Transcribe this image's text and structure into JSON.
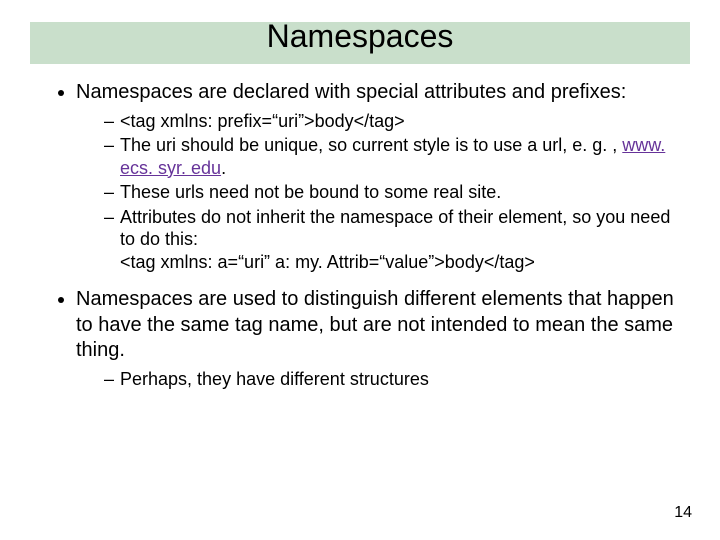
{
  "title": "Namespaces",
  "bullets": [
    {
      "text": "Namespaces are declared with special attributes and prefixes:",
      "sub": [
        {
          "text": "<tag xmlns: prefix=“uri”>body</tag>"
        },
        {
          "pre": "The uri should be unique, so current style is to use a url, e. g. , ",
          "link": "www. ecs. syr. edu",
          "post": "."
        },
        {
          "text": "These urls need not be bound to some real site."
        },
        {
          "text": "Attributes do not inherit the namespace of their element, so you need to do this:\n<tag xmlns: a=“uri” a: my. Attrib=“value”>body</tag>"
        }
      ]
    },
    {
      "text": "Namespaces are used to distinguish different elements that happen to have the same tag name, but are not intended to mean the same thing.",
      "sub": [
        {
          "text": "Perhaps, they have different structures"
        }
      ]
    }
  ],
  "page_number": "14"
}
